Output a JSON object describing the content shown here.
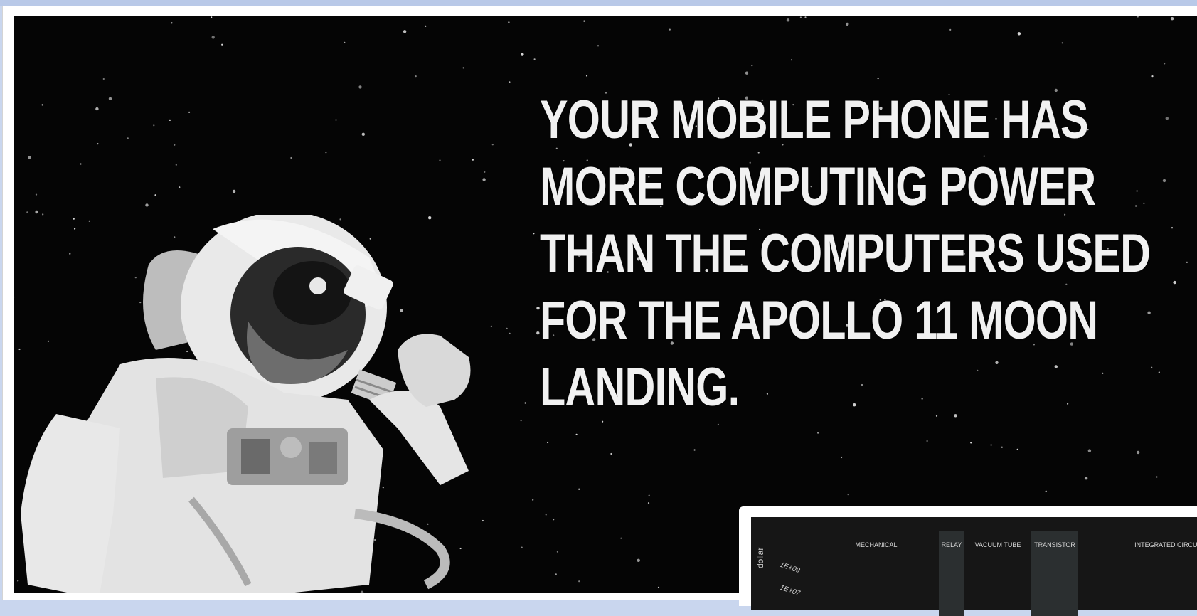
{
  "headline": {
    "line1": "YOUR MOBILE PHONE HAS",
    "line2": "MORE COMPUTING POWER",
    "line3": "THAN THE COMPUTERS USED",
    "line4": "FOR THE APOLLO 11 MOON",
    "line5": "LANDING."
  },
  "inset_chart": {
    "columns": {
      "mechanical": "MECHANICAL",
      "relay": "RELAY",
      "vacuum_tube": "VACUUM TUBE",
      "transistor": "TRANSISTOR",
      "integrated": "INTEGRATED CIRCUI"
    },
    "y_axis_label": "dollar",
    "y_ticks": {
      "t1": "1E+09",
      "t2": "1E+07"
    }
  },
  "colors": {
    "page_bg": "#c9d6ee",
    "slide_bg": "#050505",
    "headline_text": "#f1f1f1",
    "chart_bg": "#161616",
    "chart_band": "#2b2f30"
  },
  "icons": {
    "astronaut_image": "astronaut-illustration"
  }
}
